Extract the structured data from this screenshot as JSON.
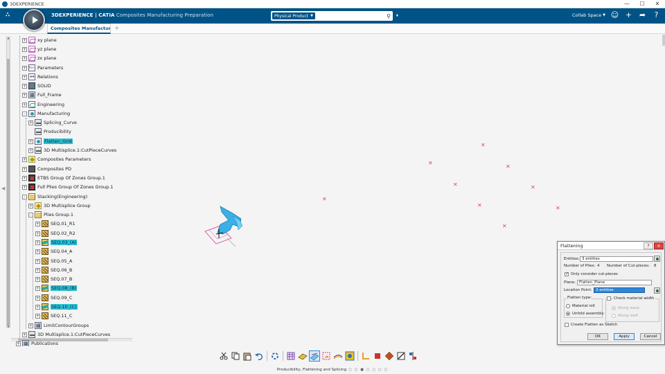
{
  "window": {
    "title": "3DEXPERIENCE",
    "controls": [
      "—",
      "☐",
      "✕"
    ]
  },
  "header": {
    "brand_bold": "3DEXPERIENCE | CATIA",
    "app_name": " Composites Manufacturing Preparation",
    "search_context": "Physical Product",
    "search_placeholder": "",
    "collab_space": "Collab Space"
  },
  "tabs": [
    {
      "label": "Composites Manufacturin"
    }
  ],
  "tree": {
    "items": [
      {
        "label": "xy plane",
        "icon": "plane-icon"
      },
      {
        "label": "yz plane",
        "icon": "plane-icon"
      },
      {
        "label": "zx plane",
        "icon": "plane-icon"
      },
      {
        "label": "Parameters",
        "icon": "parameters-icon"
      },
      {
        "label": "Relations",
        "icon": "relations-icon"
      },
      {
        "label": "SOLID",
        "icon": "geometrical-set-icon"
      },
      {
        "label": "Full_Frame",
        "icon": "geometrical-set-icon"
      },
      {
        "label": "Engineering",
        "icon": "engineering-icon"
      },
      {
        "label": "Manufacturing",
        "icon": "manufacturing-icon"
      },
      {
        "label": "Splicing_Curve",
        "icon": "curve-icon"
      },
      {
        "label": "Producibility",
        "icon": "curve-icon"
      },
      {
        "label": "Flatten_Grid",
        "icon": "flatten-icon",
        "selected": true
      },
      {
        "label": "3D Multisplice.1:CutPieceCurves",
        "icon": "curve-icon"
      },
      {
        "label": "Composites Parameters",
        "icon": "composites-parameters-icon"
      },
      {
        "label": "Composites PD",
        "icon": "composites-pd-icon"
      },
      {
        "label": "ETBS Group Of Zones Group.1",
        "icon": "zone-group-icon"
      },
      {
        "label": "Full Plies Group Of Zones Group.1",
        "icon": "zone-group-icon"
      },
      {
        "label": "Stacking(Engineering)",
        "icon": "stacking-icon"
      },
      {
        "label": "3D Multisplice Group",
        "icon": "multisplice-icon"
      },
      {
        "label": "Plies Group.1",
        "icon": "plies-group-icon"
      },
      {
        "label": "SEQ.01_R1",
        "icon": "sequence-icon"
      },
      {
        "label": "SEQ.02_R2",
        "icon": "sequence-icon"
      },
      {
        "label": "SEQ.03_(A)",
        "icon": "sequence-icon",
        "selected": true
      },
      {
        "label": "SEQ.04_A",
        "icon": "sequence-icon"
      },
      {
        "label": "SEQ.05_A",
        "icon": "sequence-icon"
      },
      {
        "label": "SEQ.06_B",
        "icon": "sequence-icon"
      },
      {
        "label": "SEQ.07_B",
        "icon": "sequence-icon"
      },
      {
        "label": "SEQ.08_(B)",
        "icon": "sequence-icon",
        "selected": true
      },
      {
        "label": "SEQ.09_C",
        "icon": "sequence-icon"
      },
      {
        "label": "SEQ.10_(C)",
        "icon": "sequence-icon",
        "selected": true
      },
      {
        "label": "SEQ.11_C",
        "icon": "sequence-icon"
      },
      {
        "label": "LimitContourGroups",
        "icon": "geometrical-set-icon"
      },
      {
        "label": "3D Multisplice.1:CutPieceCurves",
        "icon": "curve-icon"
      },
      {
        "label": "Publications",
        "icon": "publications-icon"
      }
    ]
  },
  "dialog": {
    "title": "Flattening",
    "entities_label": "Entities:",
    "entities_value": "3 entities",
    "num_plies_label": "Number of Plies:",
    "num_plies_value": "4",
    "num_cut_pieces_label": "Number of Cut-pieces:",
    "num_cut_pieces_value": "8",
    "only_cut_pieces_label": "Only consider cut-pieces",
    "plane_label": "Plane:",
    "plane_value": "Flatten_Plane",
    "location_point_label": "Location Point:",
    "location_point_value": "3 entities",
    "flatten_type_label": "Flatten type:",
    "material_roll_label": "Material roll",
    "unfold_assembly_label": "Unfold assembly",
    "check_material_width_label": "Check material width",
    "along_warp_label": "Along warp",
    "along_weft_label": "Along weft",
    "create_sketch_label": "Create Flatten as Sketch",
    "ok_label": "OK",
    "apply_label": "Apply",
    "cancel_label": "Cancel"
  },
  "workbench": {
    "label": "Producibility, Flattening and Splicing",
    "dots": "○ ○ ● ○ ○ ○ ○"
  },
  "colors": {
    "header_blue": "#005386",
    "selection_cyan": "#2bc0d4",
    "marker_magenta": "#d8409c",
    "model_cyan": "#3ab0e6"
  }
}
